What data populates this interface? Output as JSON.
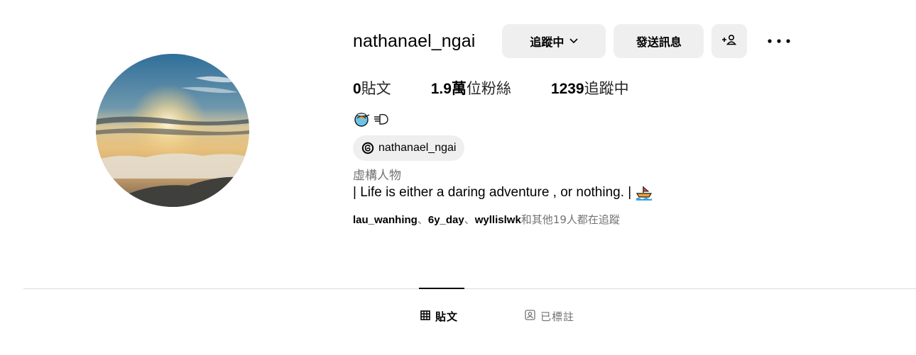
{
  "profile": {
    "username": "nathanael_ngai",
    "buttons": {
      "following": "追蹤中",
      "message": "發送訊息",
      "add_user_icon": "add-user-icon",
      "more_icon": "more-icon"
    },
    "stats": {
      "posts_count": "0",
      "posts_label": "貼文",
      "followers_count": "1.9萬",
      "followers_label": "位粉絲",
      "following_count": "1239",
      "following_label": "追蹤中"
    },
    "emojis": [
      "fish-bowl-emoji",
      "hand-emoji"
    ],
    "threads_handle": "nathanael_ngai",
    "category": "虛構人物",
    "bio": "| Life is either a daring adventure , or nothing. |",
    "bio_emoji": "boat-emoji",
    "followed_by": {
      "users": [
        "lau_wanhing",
        "6y_day",
        "wyllislwk"
      ],
      "separator": "、",
      "rest": "和其他19人都在追蹤"
    }
  },
  "tabs": {
    "posts": "貼文",
    "tagged": "已標註"
  },
  "colors": {
    "button_bg": "#efefef",
    "secondary_text": "#737373",
    "divider": "#dbdbdb"
  }
}
